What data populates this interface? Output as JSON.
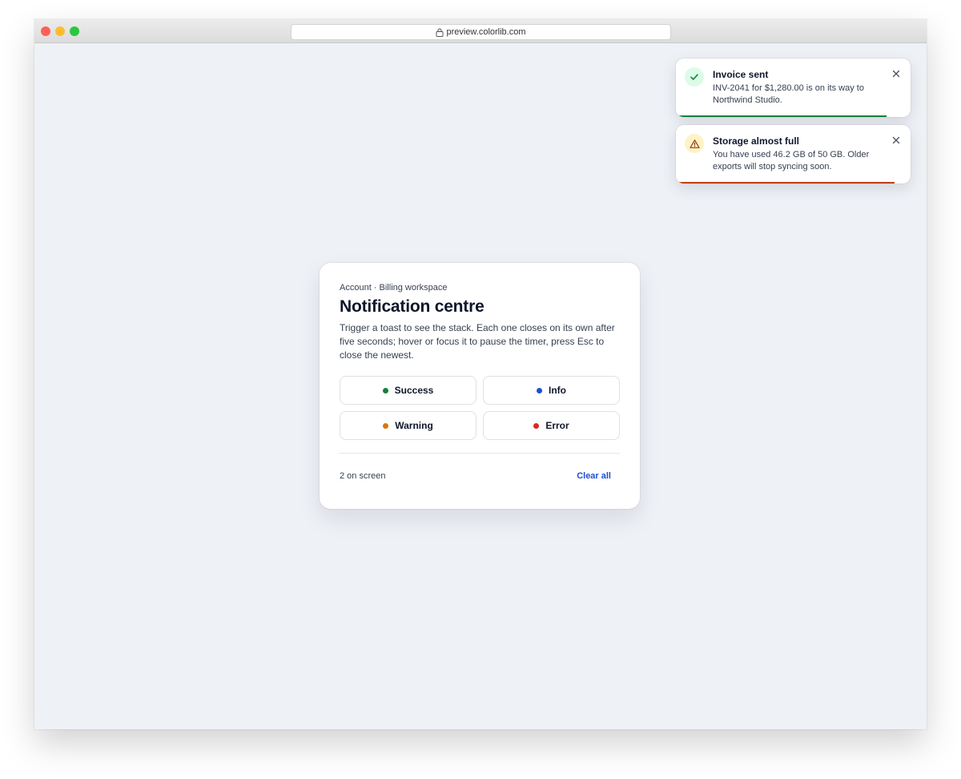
{
  "browser": {
    "url": "preview.colorlib.com"
  },
  "card": {
    "breadcrumb": "Account · Billing workspace",
    "title": "Notification centre",
    "description": "Trigger a toast to see the stack. Each one closes on its own after five seconds; hover or focus it to pause the timer, press Esc to close the newest.",
    "buttons": [
      {
        "label": "Success",
        "dot_color": "#15803d"
      },
      {
        "label": "Info",
        "dot_color": "#1d4ed8"
      },
      {
        "label": "Warning",
        "dot_color": "#d97706"
      },
      {
        "label": "Error",
        "dot_color": "#dc2626"
      }
    ],
    "count_label": "2 on screen",
    "clear_label": "Clear all"
  },
  "toasts": [
    {
      "title": "Invoice sent",
      "body": "INV-2041 for $1,280.00 is on its way to Northwind Studio.",
      "icon": "check-icon",
      "accent": "#15803d",
      "icon_bg": "#dcfce7",
      "progress": 0.899
    },
    {
      "title": "Storage almost full",
      "body": "You have used 46.2 GB of 50 GB. Older exports will stop syncing soon.",
      "icon": "warning-icon",
      "accent": "#c2410c",
      "icon_bg": "#fef3c7",
      "progress": 0.933
    }
  ]
}
